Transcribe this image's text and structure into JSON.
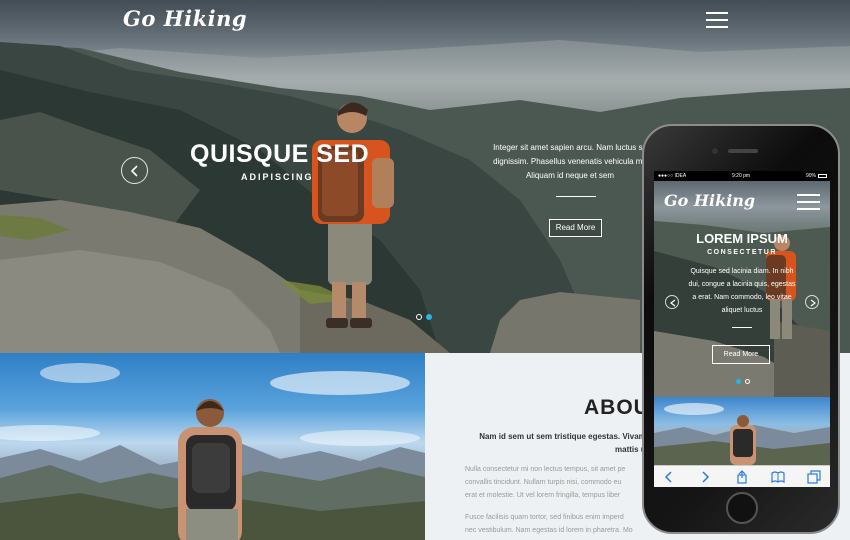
{
  "header": {
    "brand": "Go Hiking",
    "menu_icon": "hamburger-icon"
  },
  "hero": {
    "title": "QUISQUE SED",
    "subtitle": "ADIPISCING",
    "text_lines": [
      "Integer sit amet sapien arcu. Nam luctus sa",
      "dignissim. Phasellus venenatis vehicula mo",
      "Aliquam id neque et sem"
    ],
    "read_more": "Read More",
    "prev_icon": "chevron-left-icon",
    "slides": 2,
    "active_slide": 2
  },
  "about": {
    "title": "ABOU",
    "lead_lines": [
      "Nam id sem ut sem tristique egestas. Vivam",
      "mattis u"
    ],
    "para1": [
      "Nulla consectetur mi non lectus tempus, sit amet pe",
      "convallis tincidunt. Nullam turpis nisi, commodo eu",
      "erat et molestie. Ut vel lorem fringilla, tempus liber"
    ],
    "para2": [
      "Fusce facilisis quam tortor, sed finibus enim imperd",
      "nec vestibulum. Nam egestas id lorem in pharetra. Mo"
    ]
  },
  "phone": {
    "status": {
      "carrier": "●●●○○ IDEA",
      "time": "9:20 pm",
      "battery": "90%"
    },
    "brand": "Go Hiking",
    "title": "LOREM IPSUM",
    "subtitle": "CONSECTETUR",
    "text_lines": [
      "Quisque sed lacinia diam. In nibh",
      "dui, congue a lacinia quis, egestas",
      "a erat. Nam commodo, leo vitae",
      "aliquet luctus"
    ],
    "read_more": "Read More",
    "toolbar_icons": [
      "back-icon",
      "forward-icon",
      "share-icon",
      "bookmarks-icon",
      "tabs-icon"
    ]
  },
  "colors": {
    "accent": "#2bb3e6",
    "about_bg": "#eef1f3",
    "text_dark": "#222222",
    "text_muted": "#999999"
  }
}
